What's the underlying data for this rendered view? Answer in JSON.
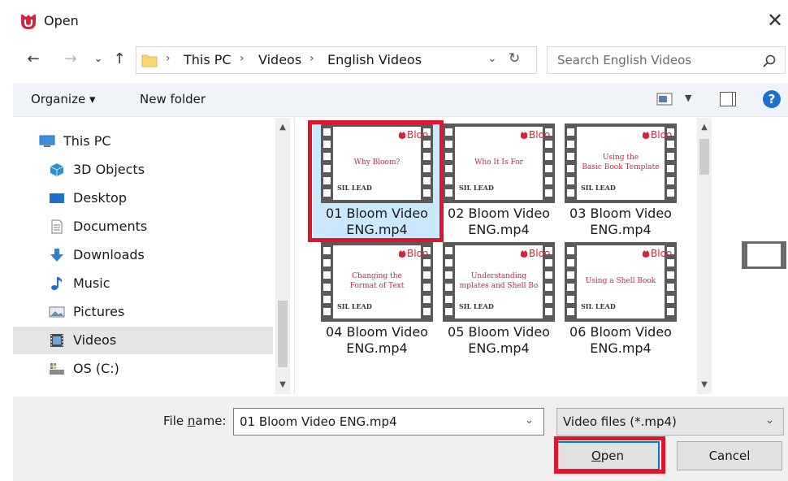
{
  "window": {
    "title": "Open",
    "close_glyph": "✕",
    "icon": "bloom-app-icon"
  },
  "nav": {
    "back_glyph": "←",
    "forward_glyph": "→",
    "recent_glyph": "⌄",
    "up_glyph": "↑"
  },
  "address": {
    "breadcrumbs": [
      "This PC",
      "Videos",
      "English Videos"
    ],
    "separator": "›",
    "dropdown_glyph": "⌄",
    "refresh_glyph": "↻"
  },
  "search": {
    "placeholder": "Search English Videos"
  },
  "toolbar": {
    "organize_label": "Organize ▾",
    "new_folder_label": "New folder",
    "view_dropdown_glyph": "▼",
    "help_glyph": "?"
  },
  "sidebar": {
    "items": [
      {
        "label": "This PC",
        "icon": "computer-icon"
      },
      {
        "label": "3D Objects",
        "icon": "3d-objects-icon"
      },
      {
        "label": "Desktop",
        "icon": "desktop-icon"
      },
      {
        "label": "Documents",
        "icon": "documents-icon"
      },
      {
        "label": "Downloads",
        "icon": "downloads-icon"
      },
      {
        "label": "Music",
        "icon": "music-icon"
      },
      {
        "label": "Pictures",
        "icon": "pictures-icon"
      },
      {
        "label": "Videos",
        "icon": "videos-icon",
        "selected": true
      },
      {
        "label": "OS (C:)",
        "icon": "drive-icon"
      }
    ]
  },
  "files": {
    "items": [
      {
        "line1": "01 Bloom Video",
        "line2": "ENG.mp4",
        "thumb_lines": [
          "Why Bloom?"
        ],
        "selected": true
      },
      {
        "line1": "02 Bloom Video",
        "line2": "ENG.mp4",
        "thumb_lines": [
          "Who It Is For"
        ]
      },
      {
        "line1": "03 Bloom Video",
        "line2": "ENG.mp4",
        "thumb_lines": [
          "Using the",
          "Basic Book Template"
        ]
      },
      {
        "line1": "04 Bloom Video",
        "line2": "ENG.mp4",
        "thumb_lines": [
          "Changing the",
          "Format of Text"
        ]
      },
      {
        "line1": "05 Bloom Video",
        "line2": "ENG.mp4",
        "thumb_lines": [
          "Understanding",
          "mplates and Shell Bo"
        ]
      },
      {
        "line1": "06 Bloom Video",
        "line2": "ENG.mp4",
        "thumb_lines": [
          "Using a Shell Book"
        ]
      }
    ],
    "thumb_brand": "Bloo",
    "thumb_footer": "SIL LEAD"
  },
  "bottom": {
    "file_name_label_pre": "File ",
    "file_name_label_u": "n",
    "file_name_label_post": "ame:",
    "file_name_value": "01 Bloom Video ENG.mp4",
    "file_type_value": "Video files (*.mp4)",
    "dropdown_glyph": "⌄",
    "open_label_u": "O",
    "open_label_rest": "pen",
    "cancel_label": "Cancel"
  },
  "colors": {
    "highlight": "#e0152c",
    "selection": "#cce8ff",
    "accent": "#0078d7"
  }
}
